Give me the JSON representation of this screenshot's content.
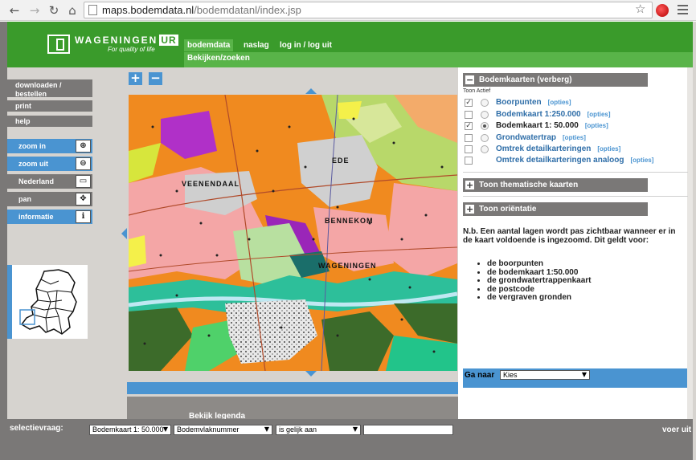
{
  "browser": {
    "url_host": "maps.bodemdata.nl",
    "url_path": "/bodemdatanl/index.jsp"
  },
  "header": {
    "logo_main": "WAGENINGEN",
    "logo_ur": "UR",
    "logo_sub": "For quality of life",
    "nav": [
      "bodemdata",
      "naslag",
      "log in / log uit"
    ],
    "subnav": "Bekijken/zoeken"
  },
  "sidebar": {
    "links": [
      "downloaden / bestellen",
      "print",
      "help"
    ],
    "tools": [
      {
        "label": "zoom in",
        "icon": "zoom-in-icon",
        "glyph": "⊕"
      },
      {
        "label": "zoom uit",
        "icon": "zoom-out-icon",
        "glyph": "⊖"
      },
      {
        "label": "Nederland",
        "icon": "full-extent-icon",
        "glyph": "▭"
      },
      {
        "label": "pan",
        "icon": "pan-icon",
        "glyph": "✥"
      },
      {
        "label": "informatie",
        "icon": "info-icon",
        "glyph": "ℹ"
      }
    ]
  },
  "map": {
    "zoom_plus": "+",
    "zoom_minus": "−",
    "labels": [
      "EDE",
      "VEENENDAAL",
      "BENNEKOM",
      "WAGENINGEN"
    ],
    "legend_link": "Bekijk legenda"
  },
  "panel": {
    "bodemkaarten_title": "Bodemkaarten (verberg)",
    "bodemkaarten_toggle": "−",
    "toon_actief": "Toon Actief",
    "opties": "[opties]",
    "layers": [
      {
        "name": "Boorpunten",
        "checked": true,
        "radio": true,
        "active": false
      },
      {
        "name": "Bodemkaart 1:250.000",
        "checked": false,
        "radio": true,
        "active": false
      },
      {
        "name": "Bodemkaart 1: 50.000",
        "checked": true,
        "radio": true,
        "active": true
      },
      {
        "name": "Grondwatertrap",
        "checked": false,
        "radio": true,
        "active": false
      },
      {
        "name": "Omtrek detailkarteringen",
        "checked": false,
        "radio": true,
        "active": false
      },
      {
        "name": "Omtrek detailkarteringen analoog",
        "checked": false,
        "radio": false,
        "active": false
      }
    ],
    "thematic_title": "Toon thematische kaarten",
    "orientatie_title": "Toon oriëntatie",
    "plus": "+",
    "note": "N.b. Een aantal lagen wordt pas zichtbaar wanneer er in de kaart voldoende is ingezoomd. Dit geldt voor:",
    "note_items": [
      "de boorpunten",
      "de bodemkaart 1:50.000",
      "de grondwatertrappenkaart",
      "de postcode",
      "de vergraven gronden"
    ],
    "ganaar_label": "Ga naar",
    "ganaar_value": "Kies"
  },
  "bottom": {
    "label": "selectievraag:",
    "select1": "Bodemkaart 1: 50.000",
    "select2": "Bodemvlaknummer",
    "select3": "is gelijk aan",
    "submit": "voer uit"
  },
  "colors": {
    "brand_green": "#3a9b2b",
    "light_green": "#59b449",
    "accent_blue": "#4a94d1",
    "panel_grey": "#7a7877"
  }
}
